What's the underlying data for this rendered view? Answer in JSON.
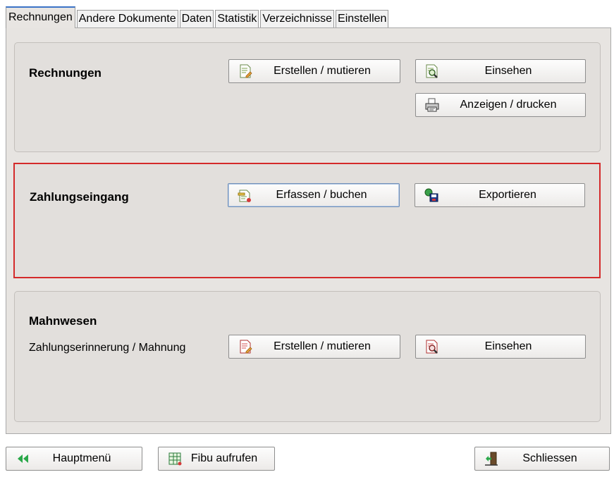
{
  "tabs": [
    "Rechnungen",
    "Andere Dokumente",
    "Daten",
    "Statistik",
    "Verzeichnisse",
    "Einstellen"
  ],
  "rechnungen": {
    "title": "Rechnungen",
    "create_label": "Erstellen / mutieren",
    "view_label": "Einsehen",
    "print_label": "Anzeigen / drucken"
  },
  "zahlungseingang": {
    "title": "Zahlungseingang",
    "capture_label": "Erfassen / buchen",
    "export_label": "Exportieren"
  },
  "mahnwesen": {
    "title": "Mahnwesen",
    "subtitle": "Zahlungserinnerung / Mahnung",
    "create_label": "Erstellen / mutieren",
    "view_label": "Einsehen"
  },
  "footer": {
    "main_menu_label": "Hauptmenü",
    "fibu_label": "Fibu aufrufen",
    "close_label": "Schliessen"
  },
  "colors": {
    "highlight_border": "#d42a2a",
    "active_tab_accent": "#3b73c7"
  }
}
